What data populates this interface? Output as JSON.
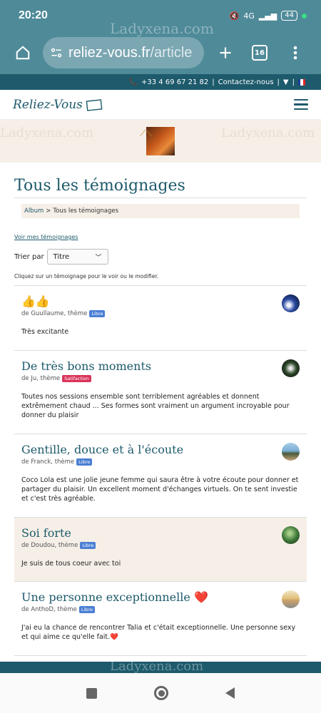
{
  "status": {
    "time": "20:20",
    "network": "4G",
    "battery": "44"
  },
  "browser": {
    "url_host": "reliez-vous.fr",
    "url_path": "/article",
    "tab_count": "16",
    "watermark": "Ladyxena.com"
  },
  "topbar": {
    "phone": "+33 4 69 67 21 82",
    "separator": "|",
    "contact": "Contactez-nous",
    "dropdown": "▼"
  },
  "site": {
    "logo": "Reliez-Vous",
    "banner_watermark": "Ladyxena.com"
  },
  "page": {
    "title": "Tous les témoignages",
    "breadcrumb": {
      "home": "Album",
      "sep": ">",
      "current": "Tous les témoignages"
    },
    "my_testimonials_link": "Voir mes témoignages",
    "sort_label": "Trier par",
    "sort_selected": "Titre",
    "hint": "Cliquez sur un témoignage pour le voir ou le modifier."
  },
  "testimonials": [
    {
      "title": "👍👍",
      "author": "de Guullaume, thème",
      "theme": "Libre",
      "theme_color": "#4a7fd4",
      "text": "Très excitante"
    },
    {
      "title": "De très bons moments",
      "author": "de Ju, thème",
      "theme": "Satifaction",
      "theme_color": "#d9345a",
      "text": "Toutes nos sessions ensemble sont terriblement agréables et donnent extrêmement chaud ... Ses formes sont vraiment un argument incroyable pour donner du plaisir"
    },
    {
      "title": "Gentille, douce et à l'écoute",
      "author": "de Franck, thème",
      "theme": "Libre",
      "theme_color": "#4a7fd4",
      "text": "Coco Lola est une jolie jeune femme qui saura être à votre écoute pour donner et partager du plaisir. Un excellent moment d'échanges virtuels. On te sent investie et c'est très agréable."
    },
    {
      "title": "Soi forte",
      "author": "de Doudou, thème",
      "theme": "Libre",
      "theme_color": "#4a7fd4",
      "text": "Je suis de tous coeur avec toi"
    },
    {
      "title": "Une personne exceptionnelle",
      "title_suffix": "❤️",
      "author": "de AnthoD, thème",
      "theme": "Libre",
      "theme_color": "#4a7fd4",
      "text": "J'ai eu la chance de rencontrer Talia et c'était exceptionnelle. Une personne sexy et qui aime ce qu'elle fait.",
      "text_suffix": "❤️"
    }
  ],
  "colors": {
    "primary": "#1d5a6b",
    "chrome": "#4f8a99",
    "cream": "#f6efe8"
  }
}
